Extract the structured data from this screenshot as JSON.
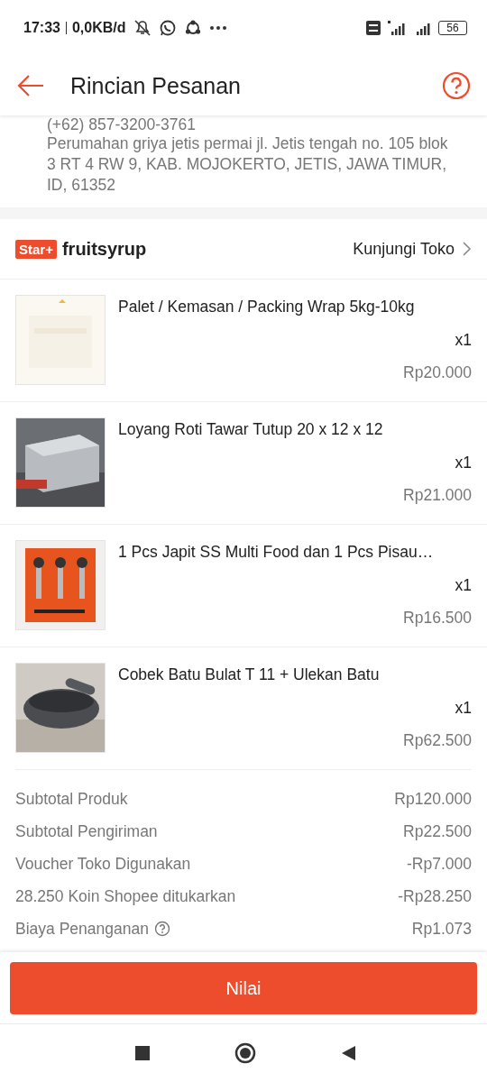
{
  "status_bar": {
    "time": "17:33",
    "data_rate": "0,0KB/d",
    "battery": "56"
  },
  "header": {
    "title": "Rincian Pesanan"
  },
  "address": {
    "phone": "(+62) 857-3200-3761",
    "text": "Perumahan griya jetis permai jl. Jetis tengah no. 105 blok 3 RT 4 RW 9, KAB. MOJOKERTO, JETIS, JAWA TIMUR, ID, 61352"
  },
  "shop": {
    "badge": "Star+",
    "name": "fruitsyrup",
    "link": "Kunjungi Toko"
  },
  "items": [
    {
      "name": "Palet / Kemasan / Packing Wrap 5kg-10kg",
      "quantity": "x1",
      "price": "Rp20.000"
    },
    {
      "name": "Loyang Roti Tawar Tutup 20 x 12 x 12",
      "quantity": "x1",
      "price": "Rp21.000"
    },
    {
      "name": "1 Pcs Japit SS Multi Food dan 1 Pcs Pisau…",
      "quantity": "x1",
      "price": "Rp16.500"
    },
    {
      "name": "Cobek Batu Bulat T 11 + Ulekan Batu",
      "quantity": "x1",
      "price": "Rp62.500"
    }
  ],
  "summary": [
    {
      "label": "Subtotal Produk",
      "value": "Rp120.000",
      "info": false
    },
    {
      "label": "Subtotal Pengiriman",
      "value": "Rp22.500",
      "info": false
    },
    {
      "label": "Voucher Toko Digunakan",
      "value": "-Rp7.000",
      "info": false
    },
    {
      "label": "28.250 Koin Shopee ditukarkan",
      "value": "-Rp28.250",
      "info": false
    },
    {
      "label": "Biaya Penanganan",
      "value": "Rp1.073",
      "info": true
    }
  ],
  "action": {
    "label": "Nilai"
  }
}
